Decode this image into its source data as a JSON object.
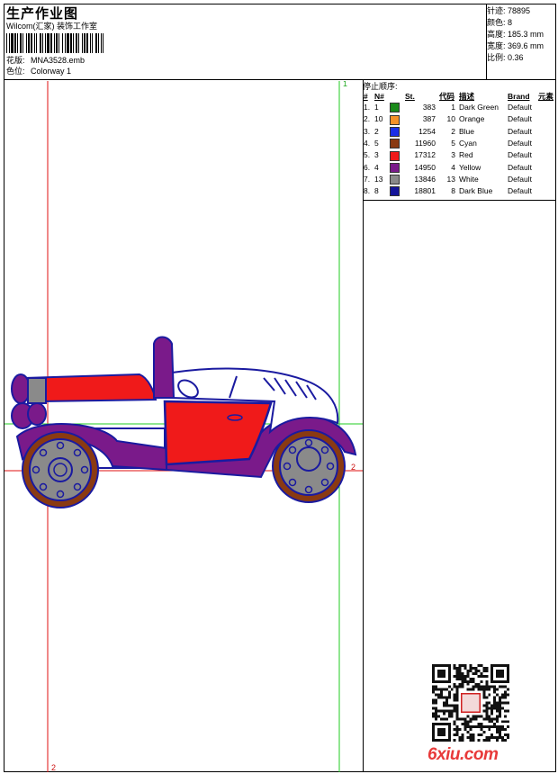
{
  "header": {
    "title": "生产作业图",
    "company": "Wilcom(汇家) 装饰工作室",
    "design_label": "花版:",
    "design_file": "MNA3528.emb",
    "colorway_label": "色位:",
    "colorway": "Colorway 1"
  },
  "stats": [
    {
      "label": "针迹:",
      "value": "78895"
    },
    {
      "label": "颜色:",
      "value": "8"
    },
    {
      "label": "高度:",
      "value": "185.3 mm"
    },
    {
      "label": "宽度:",
      "value": "369.6 mm"
    },
    {
      "label": "比例:",
      "value": "0.36"
    }
  ],
  "stop_sequence": {
    "title": "停止顺序:",
    "headers": [
      "#",
      "N#",
      "St.",
      "代码",
      "描述",
      "Brand",
      "元素"
    ],
    "rows": [
      {
        "seq": "1.",
        "n": "1",
        "color": "#1a8a1a",
        "st": "383",
        "code": "1",
        "desc": "Dark Green",
        "brand": "Default"
      },
      {
        "seq": "2.",
        "n": "10",
        "color": "#f5922a",
        "st": "387",
        "code": "10",
        "desc": "Orange",
        "brand": "Default"
      },
      {
        "seq": "3.",
        "n": "2",
        "color": "#1a2fe8",
        "st": "1254",
        "code": "2",
        "desc": "Blue",
        "brand": "Default"
      },
      {
        "seq": "4.",
        "n": "5",
        "color": "#8a3a12",
        "st": "11960",
        "code": "5",
        "desc": "Cyan",
        "brand": "Default"
      },
      {
        "seq": "5.",
        "n": "3",
        "color": "#f01a1a",
        "st": "17312",
        "code": "3",
        "desc": "Red",
        "brand": "Default"
      },
      {
        "seq": "6.",
        "n": "4",
        "color": "#7a1a8a",
        "st": "14950",
        "code": "4",
        "desc": "Yellow",
        "brand": "Default"
      },
      {
        "seq": "7.",
        "n": "13",
        "color": "#8a8a8a",
        "st": "13846",
        "code": "13",
        "desc": "White",
        "brand": "Default"
      },
      {
        "seq": "8.",
        "n": "8",
        "color": "#14149a",
        "st": "18801",
        "code": "8",
        "desc": "Dark Blue",
        "brand": "Default"
      }
    ]
  },
  "guides": {
    "green_top": "1",
    "red_right": "2",
    "red_bottom": "2"
  },
  "watermark": "6xiu.com"
}
